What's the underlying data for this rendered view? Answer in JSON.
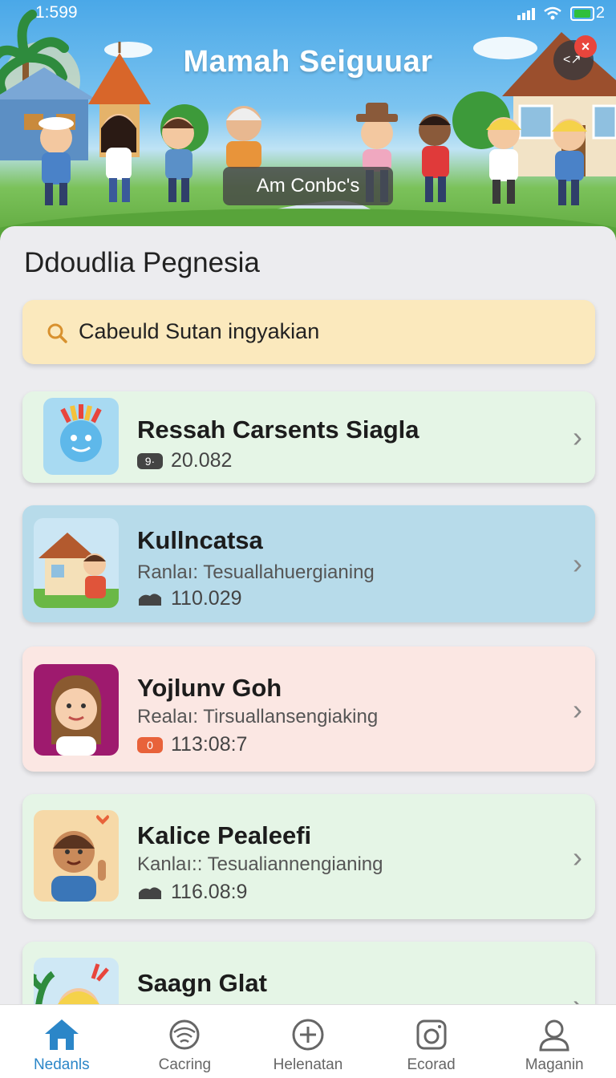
{
  "status_bar": {
    "time": "1:599",
    "battery_count": "2"
  },
  "banner": {
    "title": "Mamah Seiguuar",
    "button_label": "Am Conbc's",
    "close_symbol": "×"
  },
  "section_title": "Ddoudlia Pegnesia",
  "search": {
    "value": "Cabeuld Sutan ingyakian",
    "icon": "search-icon"
  },
  "items": [
    {
      "name": "Ressah Carsents Siagla",
      "subtitle": "",
      "badge_text": "9·",
      "value": "20.082",
      "bg": "#e5f5e6",
      "icon": "sun-face-avatar"
    },
    {
      "name": "Kullncatsa",
      "subtitle": "Ranlaı: Tesuallahuergianing",
      "value": "110.029",
      "bg": "#b7dbea",
      "icon": "house-boy-avatar"
    },
    {
      "name": "Yojlunv Goh",
      "subtitle": "Realaı: Tirsuallansengiaking",
      "badge_text": "0",
      "value": "113:08:7",
      "bg": "#fbe7e3",
      "icon": "girl-avatar"
    },
    {
      "name": "Kalice Pealeefi",
      "subtitle": "Kanlaı:: Tesualiannengianing",
      "value": "116.08:9",
      "bg": "#e5f5e6",
      "icon": "boy-avatar"
    },
    {
      "name": "Saagn Glat",
      "subtitle": "",
      "value": "",
      "bg": "#e5f5e6",
      "icon": "blond-boy-avatar"
    }
  ],
  "nav": [
    {
      "label": "Nedanls",
      "icon": "home-icon",
      "active": true
    },
    {
      "label": "Cacring",
      "icon": "wifi-globe-icon",
      "active": false
    },
    {
      "label": "Helenatan",
      "icon": "add-circle-icon",
      "active": false
    },
    {
      "label": "Ecorad",
      "icon": "camera-icon",
      "active": false
    },
    {
      "label": "Maganin",
      "icon": "profile-icon",
      "active": false
    }
  ],
  "colors": {
    "accent": "#2b86c8",
    "search_bg": "#fbe9bd",
    "close_badge": "#e8453c"
  }
}
